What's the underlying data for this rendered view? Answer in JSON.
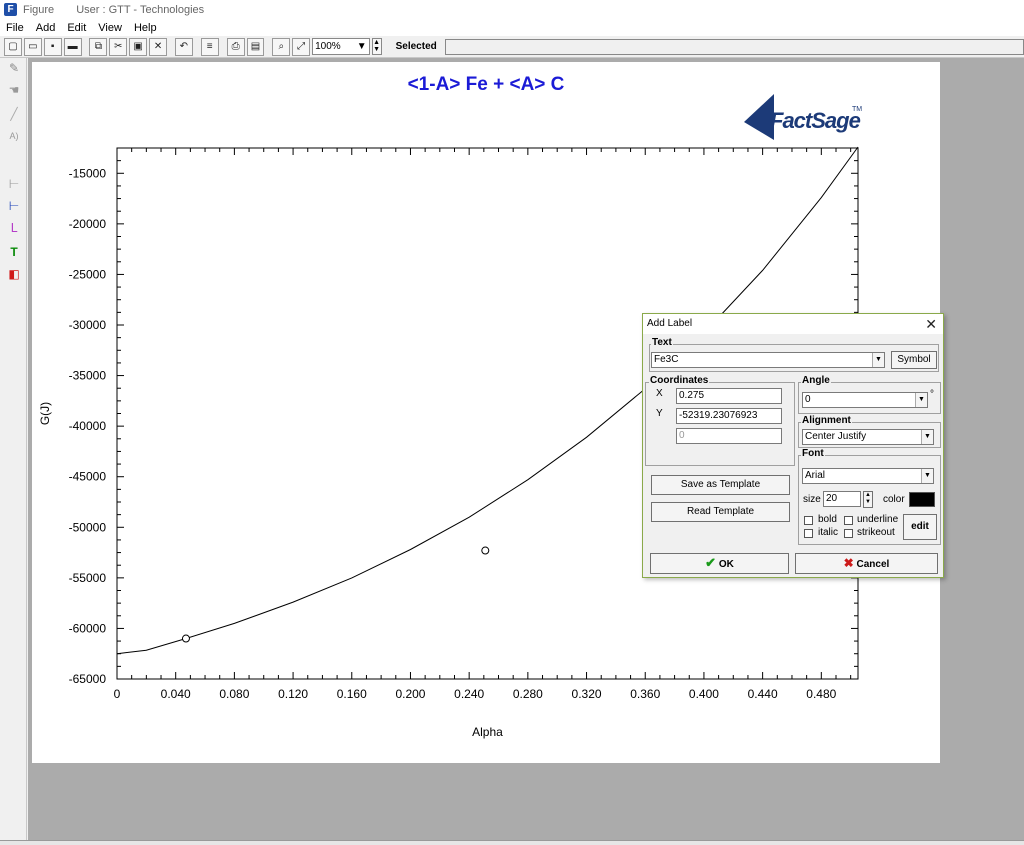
{
  "window": {
    "title": "Figure",
    "user": "User : GTT - Technologies"
  },
  "menu": [
    "File",
    "Add",
    "Edit",
    "View",
    "Help"
  ],
  "toolbar": {
    "zoom": "100%",
    "selected_label": "Selected",
    "selected_value": ""
  },
  "logo": {
    "brand": "FactSage",
    "tm": "TM"
  },
  "chart_data": {
    "type": "line",
    "title": "<1-A> Fe  +  <A> C",
    "xlabel": "Alpha",
    "ylabel": "G(J)",
    "xlim": [
      0,
      0.505
    ],
    "ylim": [
      -65000,
      -12500
    ],
    "xticks": [
      "0",
      "0.040",
      "0.080",
      "0.120",
      "0.160",
      "0.200",
      "0.240",
      "0.280",
      "0.320",
      "0.360",
      "0.400",
      "0.440",
      "0.480"
    ],
    "xtick_values": [
      0,
      0.04,
      0.08,
      0.12,
      0.16,
      0.2,
      0.24,
      0.28,
      0.32,
      0.36,
      0.4,
      0.44,
      0.48
    ],
    "yticks": [
      "-15000",
      "-20000",
      "-25000",
      "-30000",
      "-35000",
      "-40000",
      "-45000",
      "-50000",
      "-55000",
      "-60000",
      "-65000"
    ],
    "ytick_values": [
      -15000,
      -20000,
      -25000,
      -30000,
      -35000,
      -40000,
      -45000,
      -50000,
      -55000,
      -60000,
      -65000
    ],
    "series": [
      {
        "x": [
          0,
          0.02,
          0.047,
          0.08,
          0.12,
          0.16,
          0.2,
          0.24,
          0.28,
          0.32,
          0.36,
          0.4,
          0.44,
          0.48,
          0.505
        ],
        "y": [
          -62500,
          -62150,
          -61000,
          -59500,
          -57400,
          -55000,
          -52200,
          -49000,
          -45300,
          -41100,
          -36300,
          -30800,
          -24600,
          -17400,
          -12400
        ]
      }
    ],
    "points": [
      {
        "x": 0.047,
        "y": -61000
      },
      {
        "x": 0.251,
        "y": -52300
      }
    ]
  },
  "dialog": {
    "title": "Add Label",
    "close": "✕",
    "text_group": "Text",
    "text_value": "Fe3C",
    "symbol_button": "Symbol",
    "coords_group": "Coordinates",
    "x_label": "X",
    "x_value": "0.275",
    "y_label": "Y",
    "y_value": "-52319.23076923",
    "z_value": "0",
    "angle_group": "Angle",
    "angle_value": "0",
    "degree": "°",
    "alignment_group": "Alignment",
    "alignment_value": "Center Justify",
    "font_group": "Font",
    "font_value": "Arial",
    "size_label": "size",
    "size_value": "20",
    "color_label": "color",
    "color_value": "#000000",
    "bold": "bold",
    "underline": "underline",
    "italic": "italic",
    "strikeout": "strikeout",
    "edit_button": "edit",
    "save_template": "Save as Template",
    "read_template": "Read Template",
    "ok": "OK",
    "cancel": "Cancel"
  }
}
